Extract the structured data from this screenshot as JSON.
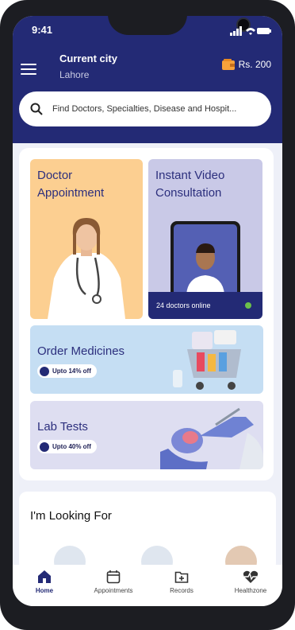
{
  "status": {
    "time": "9:41"
  },
  "header": {
    "city_title": "Current city",
    "city": "Lahore",
    "wallet_balance": "Rs. 200"
  },
  "search": {
    "placeholder": "Find Doctors, Specialties, Disease and Hospit..."
  },
  "services": {
    "doctor_appointment": "Doctor\nAppointment",
    "video_consultation": "Instant Video\nConsultation",
    "doctors_online": "24 doctors online",
    "order_medicines": "Order Medicines",
    "medicines_offer": "Upto 14% off",
    "lab_tests": "Lab Tests",
    "lab_offer": "Upto 40% off"
  },
  "looking_for": {
    "title": "I'm Looking For"
  },
  "nav": [
    {
      "label": "Home",
      "icon": "home-icon",
      "active": true
    },
    {
      "label": "Appointments",
      "icon": "calendar-icon",
      "active": false
    },
    {
      "label": "Records",
      "icon": "records-icon",
      "active": false
    },
    {
      "label": "Healthzone",
      "icon": "heart-pulse-icon",
      "active": false
    }
  ],
  "colors": {
    "primary": "#232a75",
    "doctor_tile": "#fccf91",
    "video_tile": "#c9c9e7",
    "online_dot": "#6cc04a"
  }
}
